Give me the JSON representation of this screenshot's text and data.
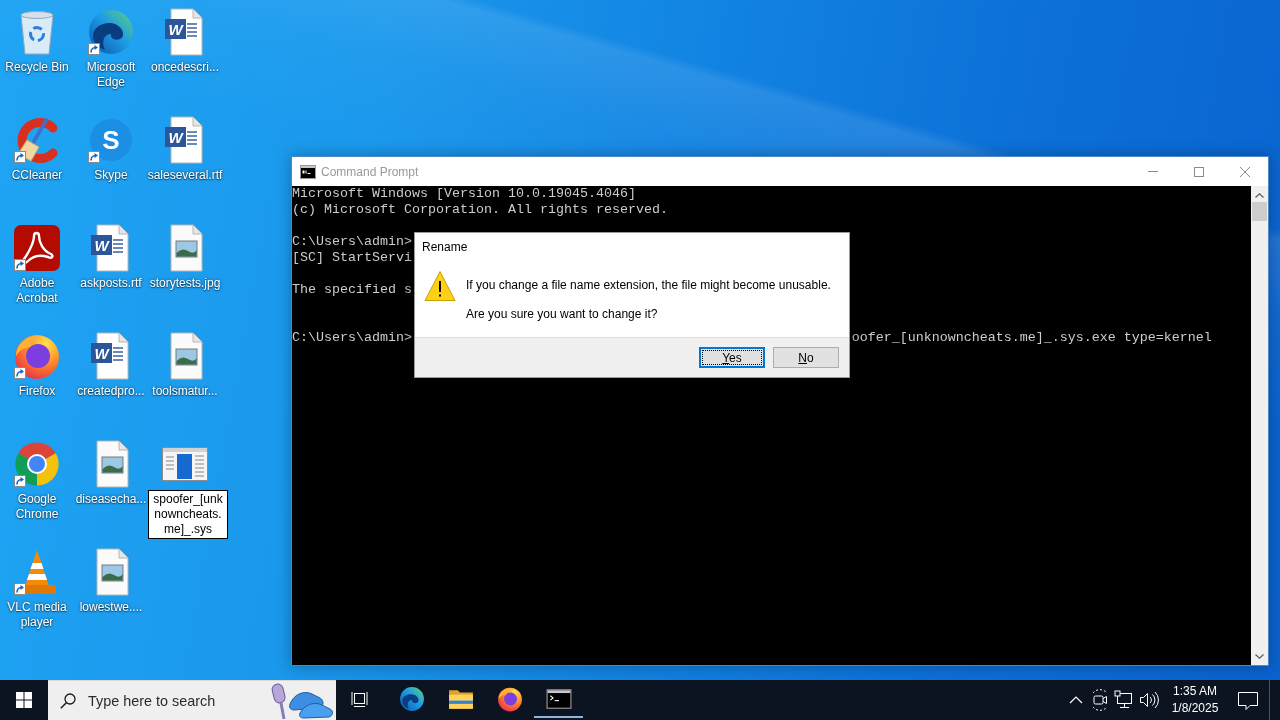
{
  "desktop_icons": [
    {
      "label": "Recycle Bin",
      "kind": "recycle-bin",
      "shortcut": false,
      "renaming": false
    },
    {
      "label": "Microsoft Edge",
      "kind": "edge",
      "shortcut": true,
      "renaming": false
    },
    {
      "label": "oncedescri...",
      "kind": "word",
      "glyph": "W",
      "shortcut": false,
      "renaming": false
    },
    {
      "label": "CCleaner",
      "kind": "ccleaner",
      "shortcut": true,
      "renaming": false
    },
    {
      "label": "Skype",
      "kind": "skype",
      "glyph": "S",
      "shortcut": true,
      "renaming": false
    },
    {
      "label": "saleseveral.rtf",
      "kind": "word",
      "glyph": "W",
      "shortcut": false,
      "renaming": false
    },
    {
      "label": "Adobe Acrobat",
      "kind": "acrobat",
      "shortcut": true,
      "renaming": false
    },
    {
      "label": "askposts.rtf",
      "kind": "word",
      "glyph": "W",
      "shortcut": false,
      "renaming": false
    },
    {
      "label": "storytests.jpg",
      "kind": "image",
      "shortcut": false,
      "renaming": false
    },
    {
      "label": "Firefox",
      "kind": "firefox",
      "shortcut": true,
      "renaming": false
    },
    {
      "label": "createdpro...",
      "kind": "word",
      "glyph": "W",
      "shortcut": false,
      "renaming": false
    },
    {
      "label": "toolsmatur...",
      "kind": "image",
      "shortcut": false,
      "renaming": false
    },
    {
      "label": "Google Chrome",
      "kind": "chrome",
      "shortcut": true,
      "renaming": false
    },
    {
      "label": "diseasecha...",
      "kind": "image",
      "shortcut": false,
      "renaming": false
    },
    {
      "label": "spoofer_[unknowncheats.me]_.sys",
      "kind": "system-file",
      "shortcut": false,
      "renaming": true
    },
    {
      "label": "VLC media player",
      "kind": "vlc",
      "shortcut": true,
      "renaming": false
    },
    {
      "label": "lowestwe....",
      "kind": "image",
      "shortcut": false,
      "renaming": false
    }
  ],
  "cmd_window": {
    "title": "Command Prompt",
    "active": false,
    "lines": [
      {
        "kind": "text",
        "text": "Microsoft Windows [Version 10.0.19045.4046]"
      },
      {
        "kind": "text",
        "text": "(c) Microsoft Corporation. All rights reserved."
      },
      {
        "kind": "blank"
      },
      {
        "kind": "text",
        "text": "C:\\Users\\admin>"
      },
      {
        "kind": "text",
        "text": "[SC] StartServi"
      },
      {
        "kind": "blank"
      },
      {
        "kind": "text",
        "text": "The specified s"
      },
      {
        "kind": "blank"
      },
      {
        "kind": "blank"
      },
      {
        "kind": "split",
        "text": "C:\\Users\\admin>",
        "tail": "oofer_[unknowncheats.me]_.sys.exe type=kernel"
      }
    ]
  },
  "dialog": {
    "title": "Rename",
    "message": "If you change a file name extension, the file might become unusable.",
    "question": "Are you sure you want to change it?",
    "buttons": [
      {
        "label": "Yes",
        "default": true
      },
      {
        "label": "No",
        "default": false
      }
    ]
  },
  "taskbar": {
    "search": {
      "placeholder": "Type here to search"
    },
    "apps": [
      {
        "kind": "edge",
        "running": false
      },
      {
        "kind": "folder",
        "running": false
      },
      {
        "kind": "firefox",
        "running": false
      },
      {
        "kind": "console",
        "running": true
      }
    ],
    "clock": {
      "time": "1:35 AM",
      "date": "1/8/2025"
    }
  }
}
